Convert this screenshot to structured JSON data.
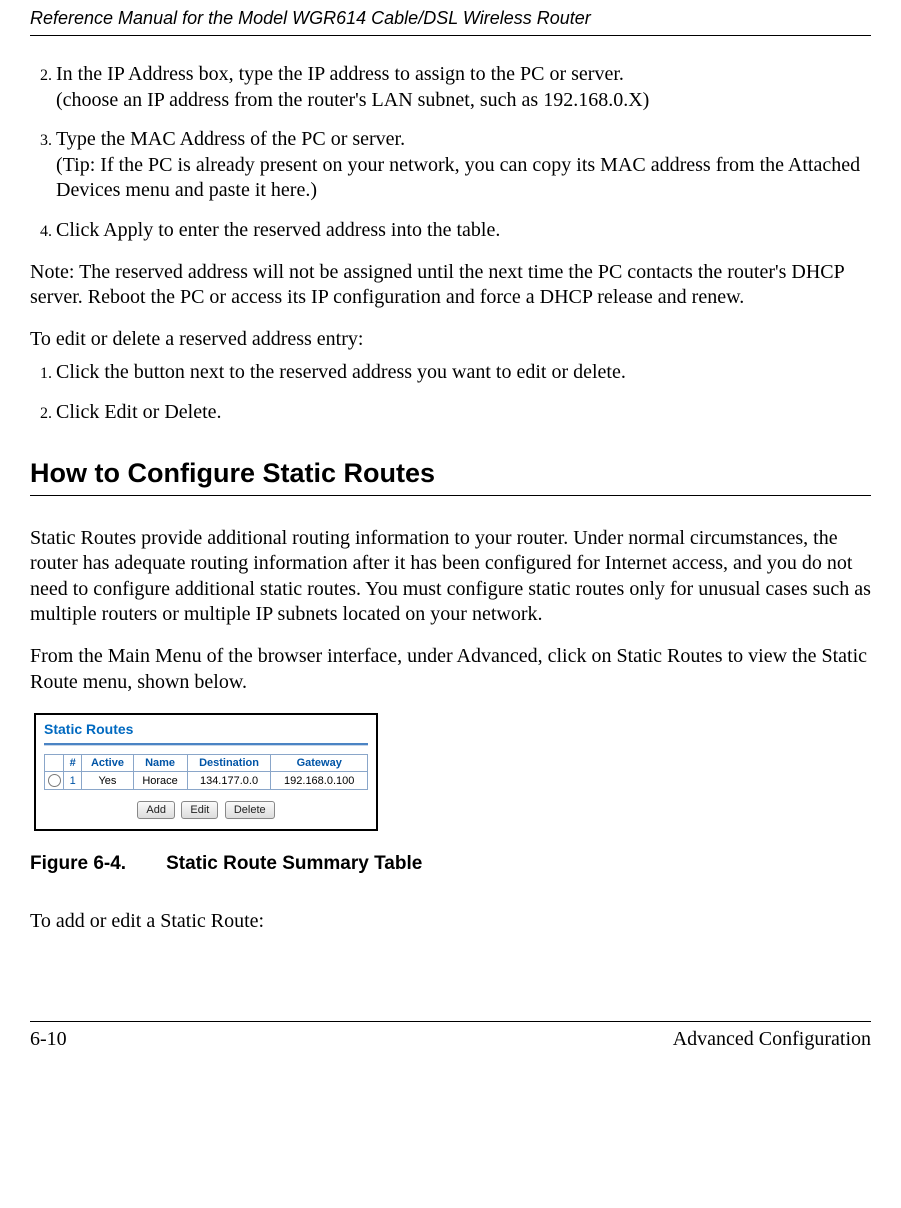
{
  "header": {
    "title": "Reference Manual for the Model WGR614 Cable/DSL Wireless Router"
  },
  "steps_a": {
    "s2": "In the IP Address box, type the IP address to assign to the PC or server.\n(choose an IP address from the router's LAN subnet, such as 192.168.0.X)",
    "s3": "Type the MAC Address of the PC or server.\n(Tip: If the PC is already present on your network, you can copy its MAC address from the Attached Devices menu and paste it here.)",
    "s4": "Click Apply to enter the reserved address into the table."
  },
  "note": "Note: The reserved address will not be assigned until the next time the PC contacts the router's DHCP server. Reboot the PC or access its IP configuration and force a DHCP release and renew.",
  "edit_intro": "To edit or delete a reserved address entry:",
  "steps_b": {
    "s1": "Click the button next to the reserved address you want to edit or delete.",
    "s2": "Click Edit or Delete."
  },
  "section_heading": "How to Configure Static Routes",
  "para1": "Static Routes provide additional routing information to your router. Under normal circumstances, the router has adequate routing information after it has been configured for Internet access, and you do not need to configure additional static routes. You must configure static routes only for unusual cases such as multiple routers or multiple IP subnets located on your network.",
  "para2": "From the Main Menu of the browser interface, under Advanced, click on Static Routes to view the Static Route menu, shown below.",
  "figure": {
    "panel_title": "Static Routes",
    "headers": {
      "num": "#",
      "active": "Active",
      "name": "Name",
      "destination": "Destination",
      "gateway": "Gateway"
    },
    "row": {
      "num": "1",
      "active": "Yes",
      "name": "Horace",
      "destination": "134.177.0.0",
      "gateway": "192.168.0.100"
    },
    "buttons": {
      "add": "Add",
      "edit": "Edit",
      "delete": "Delete"
    }
  },
  "figure_caption_num": "Figure 6-4.",
  "figure_caption_text": "Static Route Summary Table",
  "closing": "To add or edit a Static Route:",
  "footer": {
    "left": "6-10",
    "right": "Advanced Configuration"
  }
}
